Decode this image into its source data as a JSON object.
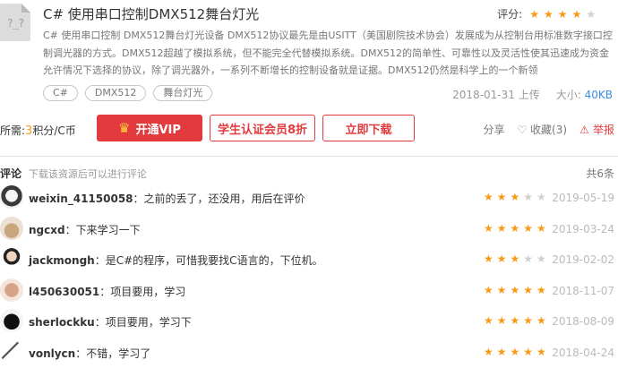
{
  "resource": {
    "title": "C# 使用串口控制DMX512舞台灯光",
    "rating_label": "评分:",
    "rating": 4,
    "description": "C# 使用串口控制 DMX512舞台灯光设备 DMX512协议最先是由USITT（美国剧院技术协会）发展成为从控制台用标准数字接口控制调光器的方式。DMX512超越了模拟系统，但不能完全代替模拟系统。DMX512的简单性、可靠性以及灵活性使其迅速成为资金允许情况下选择的协议，除了调光器外，一系列不断增长的控制设备就是证据。DMX512仍然是科学上的一个新领",
    "tags": [
      "C#",
      "DMX512",
      "舞台灯光"
    ],
    "upload_date": "2018-01-31",
    "upload_label": "上传",
    "size_label": "大小:",
    "size": "40KB"
  },
  "actions": {
    "points_prefix": "所需:",
    "points": "3",
    "points_suffix": "积分/C币",
    "vip_label": "开通VIP",
    "student_label": "学生认证会员8折",
    "download_label": "立即下载",
    "share_label": "分享",
    "favorite_label": "收藏(3)",
    "report_label": "举报"
  },
  "comments": {
    "title": "评论",
    "subtitle": "下载该资源后可以进行评论",
    "count": "共6条",
    "items": [
      {
        "user": "weixin_41150058",
        "text": "之前的丢了，还没用，用后在评价",
        "stars": 3,
        "date": "2019-05-19"
      },
      {
        "user": "ngcxd",
        "text": "下来学习一下",
        "stars": 5,
        "date": "2019-03-24"
      },
      {
        "user": "jackmongh",
        "text": "是C#的程序，可惜我要找C语言的，下位机。",
        "stars": 3,
        "date": "2019-02-02"
      },
      {
        "user": "l450630051",
        "text": "项目要用，学习",
        "stars": 5,
        "date": "2018-11-07"
      },
      {
        "user": "sherlockku",
        "text": "项目要用，学习下",
        "stars": 5,
        "date": "2018-08-09"
      },
      {
        "user": "vonlycn",
        "text": "不错，学习了",
        "stars": 5,
        "date": "2018-04-24"
      }
    ]
  },
  "colors": {
    "accent": "#e23a3d",
    "star": "#f79a14",
    "link": "#3a8ee6"
  }
}
